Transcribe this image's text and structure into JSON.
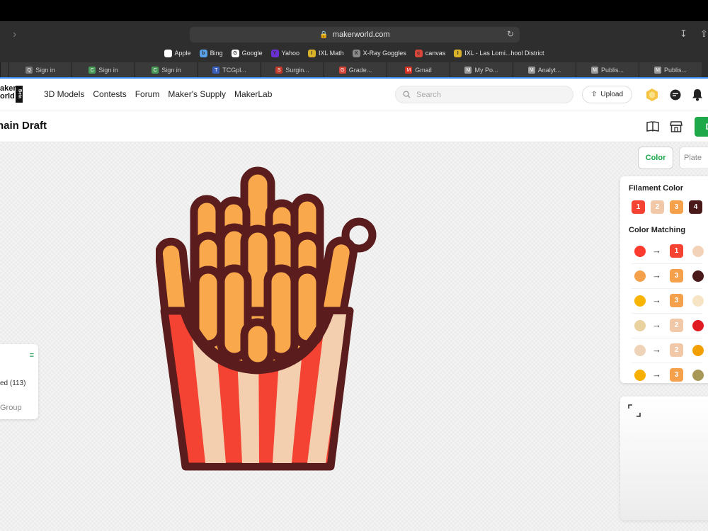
{
  "browser": {
    "url": "makerworld.com",
    "favorites": [
      {
        "label": "Apple",
        "color": "#ffffff",
        "glyph": ""
      },
      {
        "label": "Bing",
        "color": "#5aa0e8",
        "glyph": "b"
      },
      {
        "label": "Google",
        "color": "#ffffff",
        "glyph": "G"
      },
      {
        "label": "Yahoo",
        "color": "#6b2fd6",
        "glyph": "Y"
      },
      {
        "label": "IXL Math",
        "color": "#d8b32a",
        "glyph": "I"
      },
      {
        "label": "X-Ray Goggles",
        "color": "#888888",
        "glyph": "X"
      },
      {
        "label": "canvas",
        "color": "#d8463b",
        "glyph": "c"
      },
      {
        "label": "IXL - Las Lomi...hool District",
        "color": "#d8b32a",
        "glyph": "I"
      }
    ],
    "tabs": [
      {
        "label": "Sign in",
        "icon": "Q",
        "color": "#777"
      },
      {
        "label": "Sign in",
        "icon": "C",
        "color": "#4a9a5a"
      },
      {
        "label": "Sign in",
        "icon": "C",
        "color": "#4a9a5a"
      },
      {
        "label": "TCGpl...",
        "icon": "T",
        "color": "#3a5fb8"
      },
      {
        "label": "Surgin...",
        "icon": "S",
        "color": "#c0392b"
      },
      {
        "label": "Grade...",
        "icon": "G",
        "color": "#d8463b"
      },
      {
        "label": "Gmail",
        "icon": "M",
        "color": "#d93025"
      },
      {
        "label": "My Po...",
        "icon": "M",
        "color": "#999"
      },
      {
        "label": "Analyt...",
        "icon": "M",
        "color": "#999"
      },
      {
        "label": "Publis...",
        "icon": "M",
        "color": "#999"
      },
      {
        "label": "Publis...",
        "icon": "M",
        "color": "#999"
      }
    ]
  },
  "app": {
    "logo_line1": "aker",
    "logo_line2": "orld",
    "logo_badge": "Beta",
    "nav": [
      "3D Models",
      "Contests",
      "Forum",
      "Maker's Supply",
      "MakerLab"
    ],
    "search_placeholder": "Search",
    "upload_label": "Upload"
  },
  "titlebar": {
    "title": "hain Draft",
    "action_label": "D"
  },
  "left_panel": {
    "row1": "ed (113)",
    "row2": "Group"
  },
  "view_tabs": {
    "color": "Color",
    "plate": "Plate"
  },
  "filament": {
    "title": "Filament Color",
    "swatches": [
      {
        "num": "1",
        "color": "#f44332"
      },
      {
        "num": "2",
        "color": "#f2c9a8"
      },
      {
        "num": "3",
        "color": "#f5a04a"
      },
      {
        "num": "4",
        "color": "#4a1a1a"
      }
    ]
  },
  "matching": {
    "title": "Color Matching",
    "rows": [
      {
        "from": "#ff3b30",
        "to_num": "1",
        "to_color": "#f44332",
        "right": "#f2d2b8"
      },
      {
        "from": "#f5a04a",
        "to_num": "3",
        "to_color": "#f5a04a",
        "right": "#4a1a1a"
      },
      {
        "from": "#f8b400",
        "to_num": "3",
        "to_color": "#f5a04a",
        "right": "#f7e4c4"
      },
      {
        "from": "#ead1a0",
        "to_num": "2",
        "to_color": "#f2c9a8",
        "right": "#e11b22"
      },
      {
        "from": "#eed3b8",
        "to_num": "2",
        "to_color": "#f2c9a8",
        "right": "#f2a000"
      },
      {
        "from": "#f8b000",
        "to_num": "3",
        "to_color": "#f5a04a",
        "right": "#a89858"
      }
    ]
  },
  "colors": {
    "brand_green": "#1ea84a",
    "fry_outline": "#5a1c1c",
    "fry_fill": "#f9a94b",
    "box_red": "#f44332",
    "box_cream": "#f3cfb0"
  }
}
